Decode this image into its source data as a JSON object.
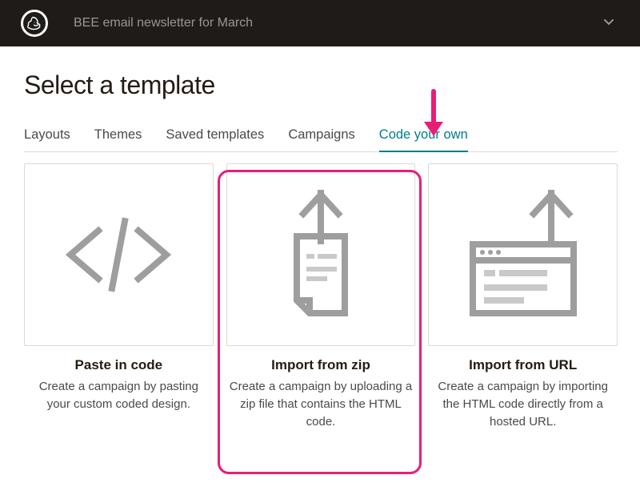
{
  "topbar": {
    "campaign_name": "BEE email newsletter for March"
  },
  "page_title": "Select a template",
  "tabs": [
    {
      "label": "Layouts",
      "active": false
    },
    {
      "label": "Themes",
      "active": false
    },
    {
      "label": "Saved templates",
      "active": false
    },
    {
      "label": "Campaigns",
      "active": false
    },
    {
      "label": "Code your own",
      "active": true
    }
  ],
  "cards": [
    {
      "title": "Paste in code",
      "desc": "Create a campaign by pasting your custom coded design."
    },
    {
      "title": "Import from zip",
      "desc": "Create a campaign by uploading a zip file that contains the HTML code."
    },
    {
      "title": "Import from URL",
      "desc": "Create a campaign by importing the HTML code directly from a hosted URL."
    }
  ],
  "highlight_card_index": 1
}
